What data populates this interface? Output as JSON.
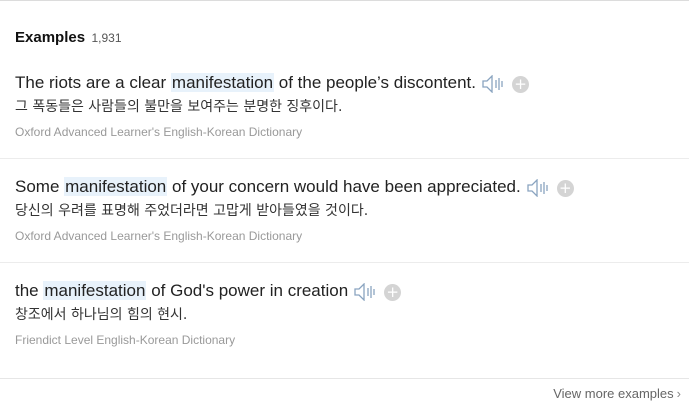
{
  "header": {
    "title": "Examples",
    "count": "1,931"
  },
  "examples": [
    {
      "en_before": "The riots are a clear ",
      "en_highlight": "manifestation",
      "en_after": " of the people’s discontent.",
      "ko": "그 폭동들은 사람들의 불만을 보여주는 분명한 징후이다.",
      "source": "Oxford Advanced Learner's English-Korean Dictionary"
    },
    {
      "en_before": "Some ",
      "en_highlight": "manifestation",
      "en_after": " of your concern would have been appreciated.",
      "ko": "당신의 우려를 표명해 주었더라면 고맙게 받아들였을 것이다.",
      "source": "Oxford Advanced Learner's English-Korean Dictionary"
    },
    {
      "en_before": "the ",
      "en_highlight": "manifestation",
      "en_after": " of God's power in creation",
      "ko": "창조에서 하나님의 힘의 현시.",
      "source": "Friendict Level English-Korean Dictionary"
    }
  ],
  "footer": {
    "view_more_label": "View more examples",
    "chevron": "›"
  },
  "icons": {
    "audio": "speaker-icon",
    "add": "plus-circle-icon",
    "add_glyph": "+"
  },
  "colors": {
    "highlight": "#e8f2fb",
    "source_text": "#999999",
    "add_button": "#d4d4d4"
  }
}
